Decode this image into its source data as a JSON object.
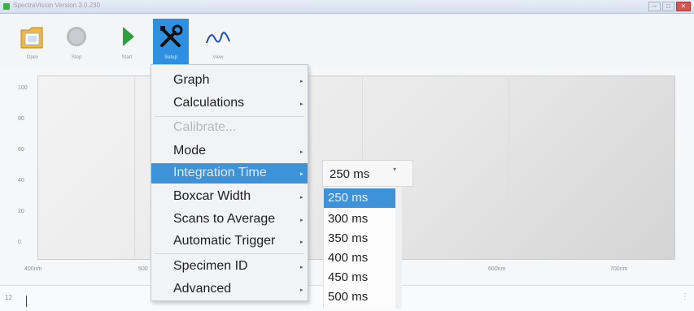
{
  "window": {
    "title": "SpectraVision Version 3.0.230"
  },
  "toolbar": {
    "open": "Open",
    "stop": "Stop",
    "start": "Start",
    "setup": "Setup",
    "view": "View"
  },
  "graph": {
    "y_ticks": [
      "100",
      "80",
      "60",
      "40",
      "20",
      "0"
    ],
    "x_ticks": [
      "400nm",
      "500",
      "600nm",
      "700nm"
    ]
  },
  "menu": {
    "items": [
      {
        "label": "Graph"
      },
      {
        "label": "Calculations"
      },
      {
        "label": "Calibrate..."
      },
      {
        "label": "Mode"
      },
      {
        "label": "Integration Time"
      },
      {
        "label": "Boxcar Width"
      },
      {
        "label": "Scans to Average"
      },
      {
        "label": "Automatic Trigger"
      },
      {
        "label": "Specimen ID"
      },
      {
        "label": "Advanced"
      }
    ]
  },
  "integration": {
    "current": "250 ms",
    "options": [
      "250 ms",
      "300 ms",
      "350 ms",
      "400 ms",
      "450 ms",
      "500 ms"
    ]
  },
  "status": {
    "value": "12"
  },
  "colors": {
    "accent": "#3e92d7",
    "start_green": "#2e9e3e"
  }
}
